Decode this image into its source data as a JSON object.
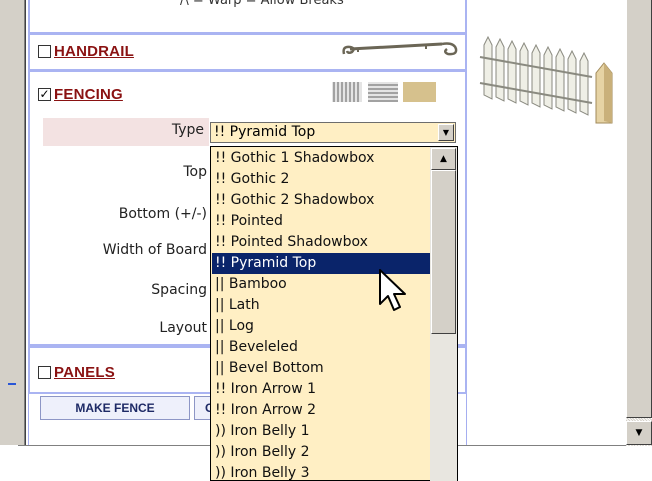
{
  "top_partial_text": "/\\ = Warp = Allow Breaks",
  "sections": {
    "handrail": {
      "label": "HANDRAIL",
      "checked": false,
      "check_glyph": ""
    },
    "fencing": {
      "label": "FENCING",
      "checked": true,
      "check_glyph": "✓"
    },
    "panels": {
      "label": "PANELS",
      "checked": false,
      "check_glyph": ""
    }
  },
  "fencing_form": {
    "type_label": "Type",
    "top_label": "Top",
    "bottom_label": "Bottom (+/-)",
    "width_label": "Width of Board",
    "spacing_label": "Spacing",
    "layout_label": "Layout",
    "type_value": "!! Pyramid Top"
  },
  "dropdown": {
    "items": [
      "!! Gothic 1 Shadowbox",
      "!! Gothic 2",
      "!! Gothic 2 Shadowbox",
      "!! Pointed",
      "!! Pointed Shadowbox",
      "!! Pyramid Top",
      "|| Bamboo",
      "|| Lath",
      "|| Log",
      "|| Beveleled",
      "|| Bevel Bottom",
      "!! Iron Arrow 1",
      "!! Iron Arrow 2",
      ")) Iron Belly 1",
      ")) Iron Belly 2",
      ")) Iron Belly 3"
    ],
    "selected_index": 5
  },
  "buttons": {
    "make_fence": "MAKE FENCE",
    "second_partial": "C"
  },
  "icons": {
    "handrail": "handrail-scroll-icon",
    "fence_vertical": "vertical-boards-icon",
    "fence_horizontal": "horizontal-boards-icon",
    "fence_panel": "solid-panel-icon",
    "preview": "picket-fence-preview",
    "cursor": "arrow-cursor-icon"
  },
  "colors": {
    "section_title": "#8a1212",
    "section_border": "#aab4f2",
    "dropdown_bg": "#ffefc4",
    "selection": "#0a246a",
    "type_row_highlight": "#f3e2e2"
  }
}
